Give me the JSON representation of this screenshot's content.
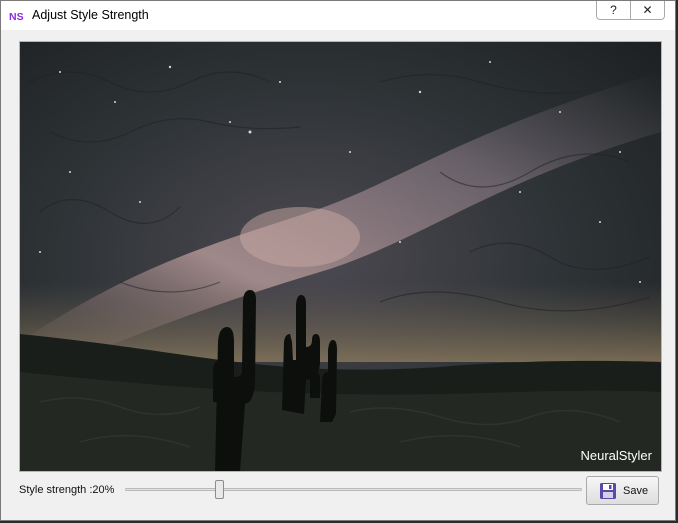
{
  "window": {
    "title": "Adjust Style Strength",
    "app_icon": "NS"
  },
  "titlebar_buttons": {
    "help": "?",
    "close": "✕"
  },
  "preview": {
    "watermark": "NeuralStyler"
  },
  "controls": {
    "strength_label": "Style strength :20%",
    "strength_value": 0.2,
    "save_label": "Save",
    "save_icon": "floppy-disk-icon"
  }
}
